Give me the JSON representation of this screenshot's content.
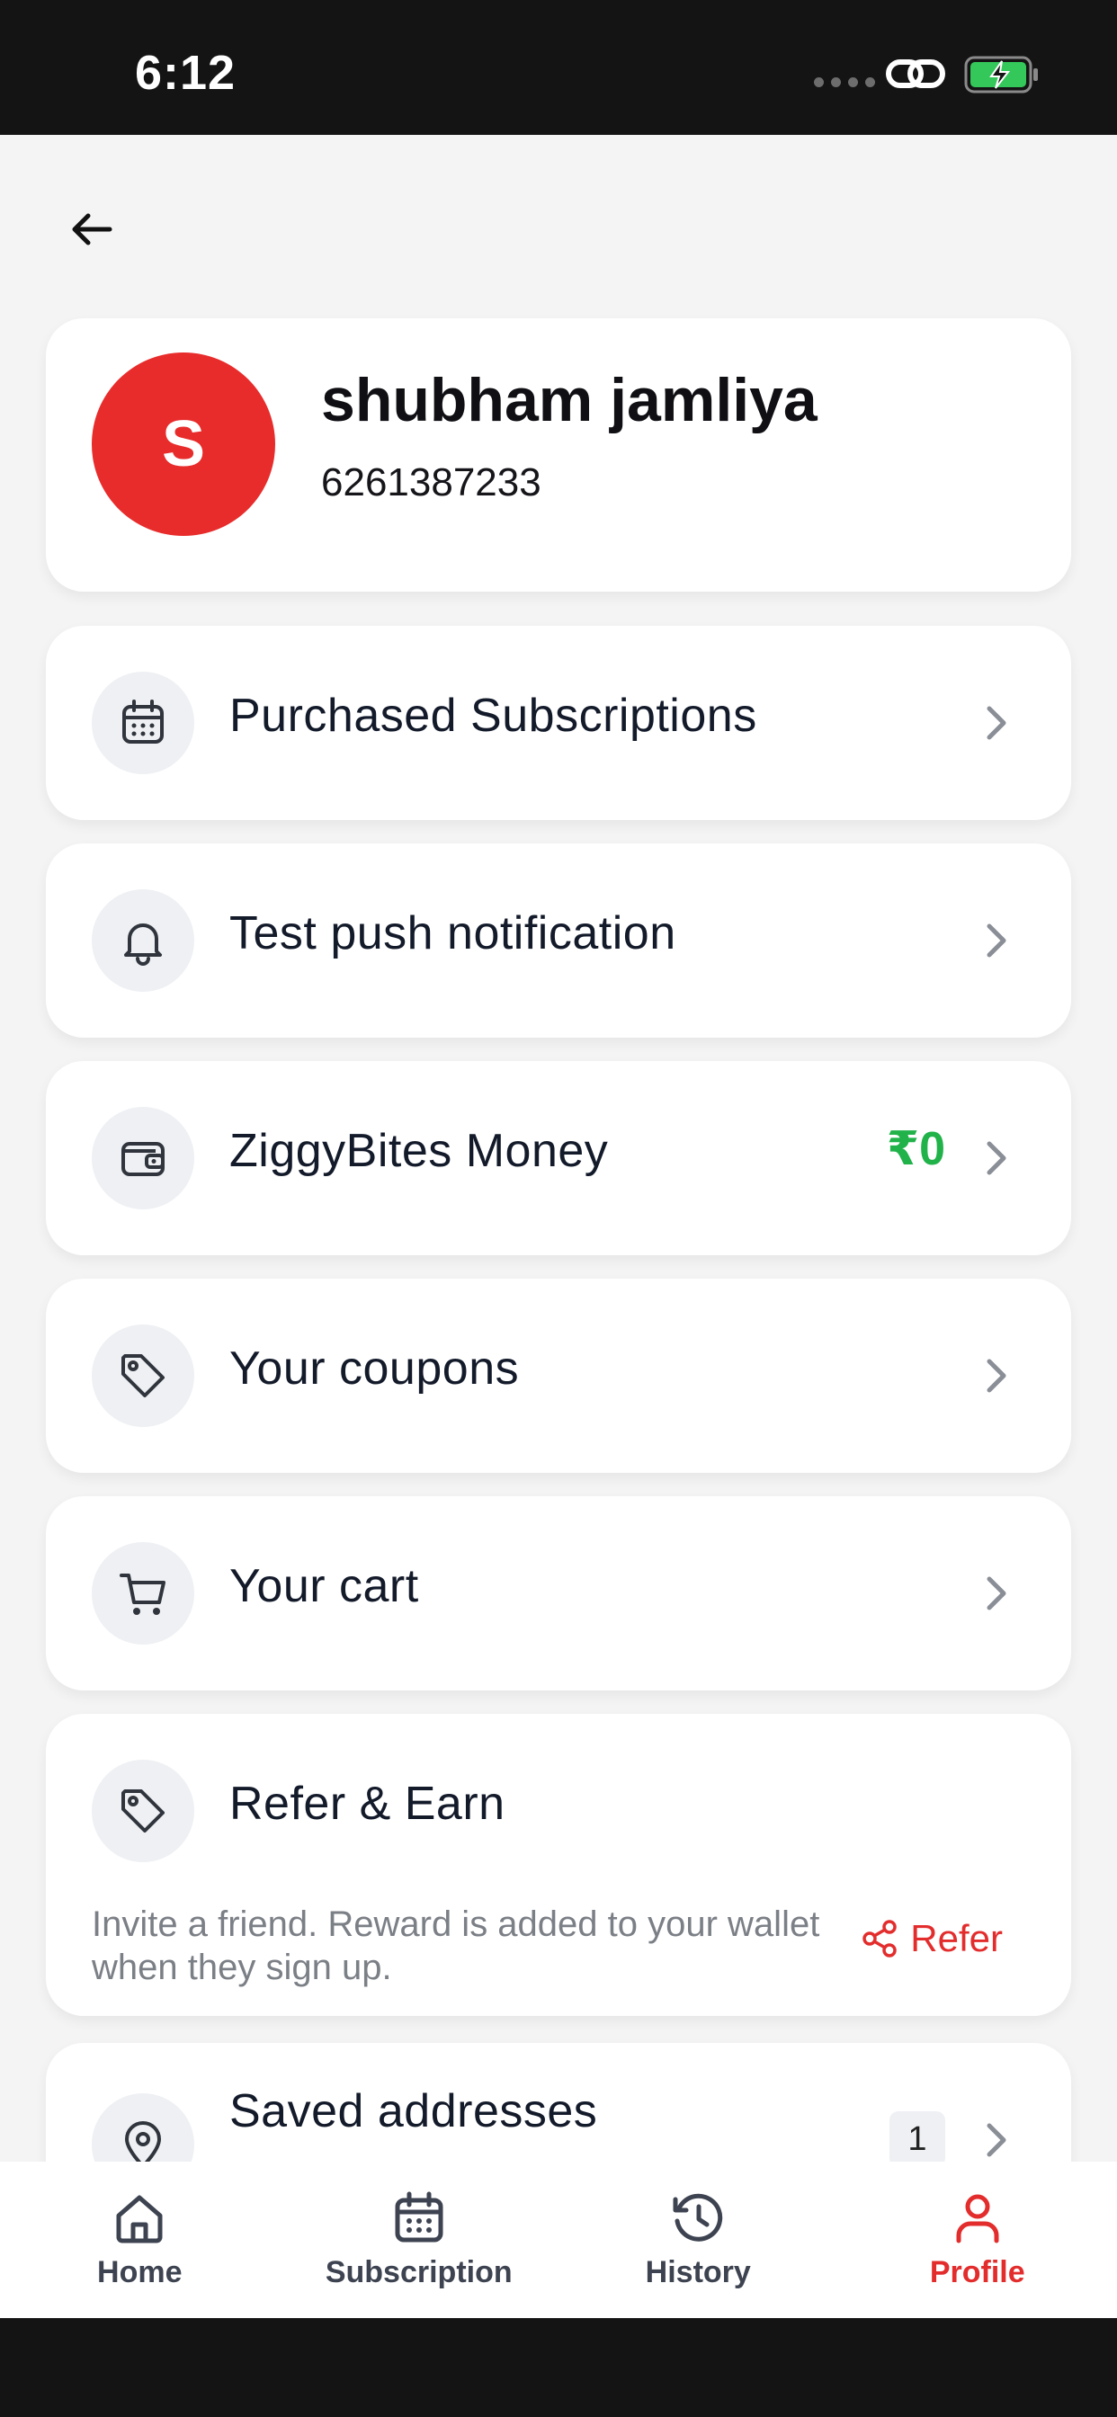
{
  "status_bar": {
    "time": "6:12"
  },
  "profile": {
    "initial": "S",
    "name": "shubham jamliya",
    "phone": "6261387233"
  },
  "menu": {
    "subscriptions": "Purchased Subscriptions",
    "push": "Test push notification",
    "money": "ZiggyBites Money",
    "money_value": "₹0",
    "coupons": "Your coupons",
    "cart": "Your cart"
  },
  "refer": {
    "title": "Refer & Earn",
    "description": "Invite a friend. Reward is added to your wallet when they sign up.",
    "button": "Refer"
  },
  "addresses": {
    "title": "Saved addresses",
    "count": "1"
  },
  "nav": {
    "home": "Home",
    "subscription": "Subscription",
    "history": "History",
    "profile": "Profile",
    "active": "Profile"
  },
  "colors": {
    "accent": "#e32d2d",
    "money": "#21b24a",
    "avatar": "#e82b2b"
  }
}
